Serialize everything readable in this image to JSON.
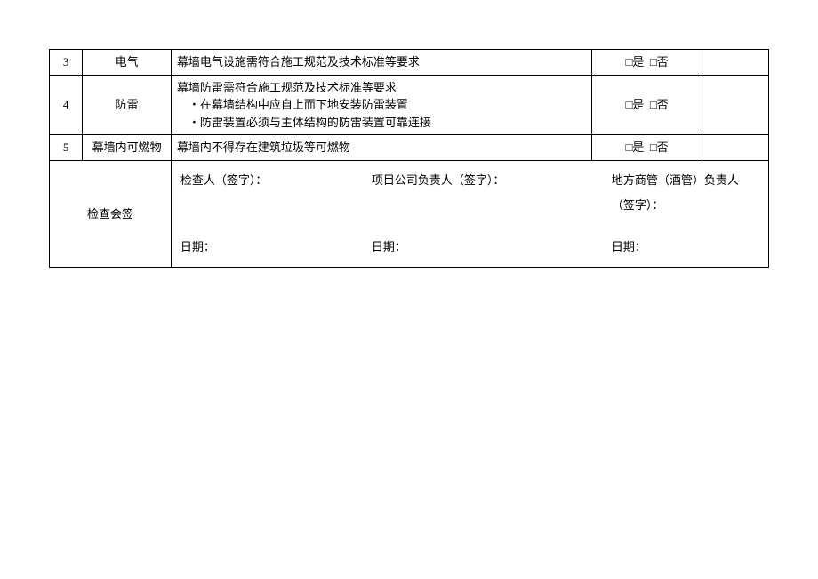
{
  "rows": [
    {
      "num": "3",
      "category": "电气",
      "desc_lines": [
        "幕墙电气设施需符合施工规范及技术标准等要求"
      ],
      "check_yes": "□是",
      "check_no": "□否"
    },
    {
      "num": "4",
      "category": "防雷",
      "desc_lines": [
        "幕墙防雷需符合施工规范及技术标准等要求",
        "・在幕墙结构中应自上而下地安装防雷装置",
        "・防雷装置必须与主体结构的防雷装置可靠连接"
      ],
      "check_yes": "□是",
      "check_no": "□否"
    },
    {
      "num": "5",
      "category": "幕墙内可燃物",
      "desc_lines": [
        "幕墙内不得存在建筑垃圾等可燃物"
      ],
      "check_yes": "□是",
      "check_no": "□否"
    }
  ],
  "signoff": {
    "label": "检查会签",
    "inspector_label": "检查人（签字）：",
    "project_label": "项目公司负责人（签字）：",
    "local_label": "地方商管（酒管）负责人（签字）：",
    "date_label": "日期："
  }
}
